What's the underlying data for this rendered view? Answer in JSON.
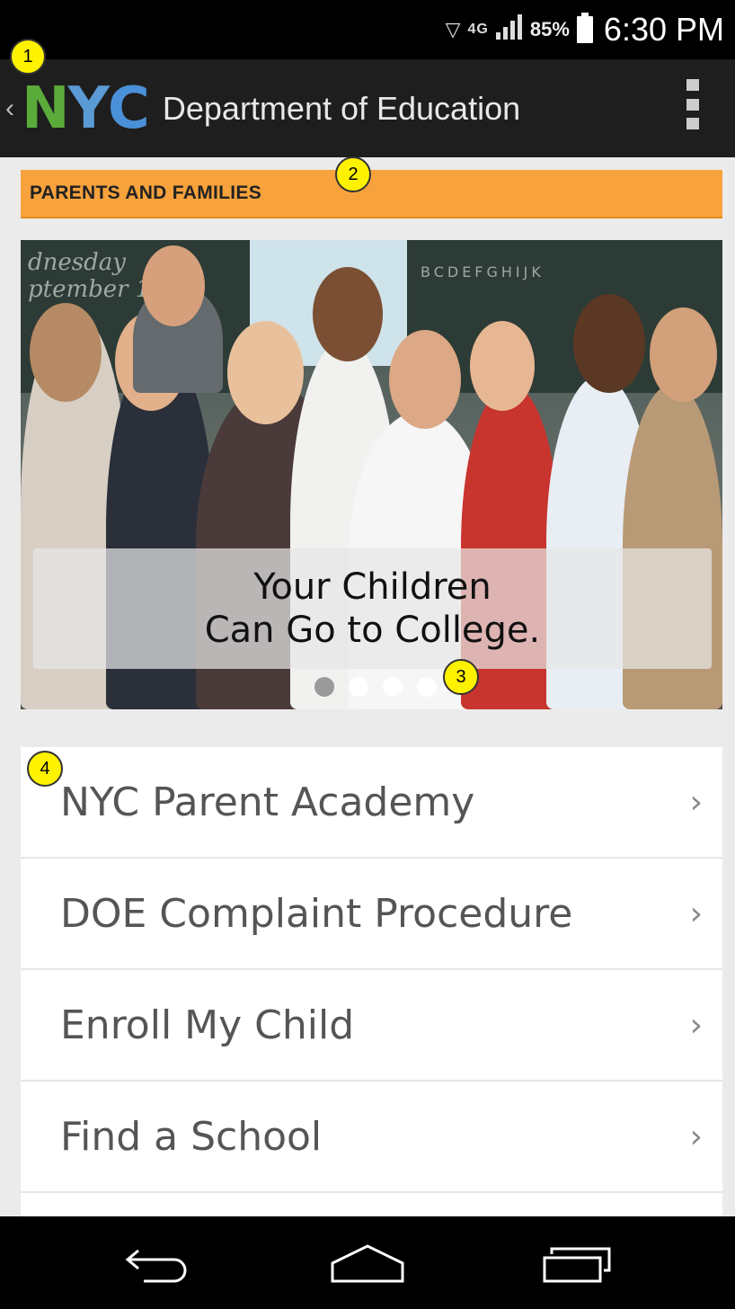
{
  "status_bar": {
    "wifi_icon": "wifi-icon",
    "network": "4G",
    "signal_icon": "signal-icon",
    "battery_percent": "85%",
    "battery_icon": "battery-icon",
    "time": "6:30 PM"
  },
  "header": {
    "back_icon": "chevron-left-icon",
    "logo": {
      "n": "N",
      "y": "Y",
      "c": "C"
    },
    "title": "Department of Education",
    "menu_icon": "overflow-menu-icon"
  },
  "section": {
    "title": "PARENTS  AND FAMILIES"
  },
  "carousel": {
    "caption_line1": "Your Children",
    "caption_line2": "Can Go to College.",
    "board_text_left": "dnesday\nptember 10",
    "board_text_right": "BCDEFGHIJK",
    "dots_total": 4,
    "active_dot_index": 0
  },
  "menu": {
    "items": [
      {
        "label": "NYC Parent Academy",
        "chevron": "›"
      },
      {
        "label": "DOE Complaint Procedure",
        "chevron": "›"
      },
      {
        "label": "Enroll My Child",
        "chevron": "›"
      },
      {
        "label": "Find a School",
        "chevron": "›"
      }
    ]
  },
  "nav_bar": {
    "back_icon": "nav-back-icon",
    "home_icon": "nav-home-icon",
    "recents_icon": "nav-recents-icon"
  },
  "annotations": {
    "m1": "1",
    "m2": "2",
    "m3": "3",
    "m4": "4"
  },
  "colors": {
    "banner": "#f7a23c",
    "header_bg": "#1e1e1e",
    "logo_green": "#5bab3a",
    "logo_blue": "#4a90d9",
    "marker": "#fff200"
  }
}
